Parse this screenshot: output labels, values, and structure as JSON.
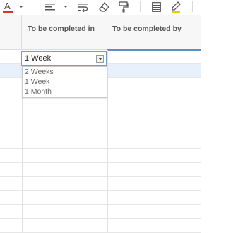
{
  "toolbar": {
    "icons": [
      "font-color-icon",
      "dropdown-arrow-icon",
      "align-left-icon",
      "dropdown-arrow-icon",
      "wrap-text-icon",
      "eraser-icon",
      "format-painter-icon",
      "freeze-columns-icon",
      "highlighter-icon"
    ],
    "font_color_letter": "A",
    "font_color": "#d9342b"
  },
  "columns": {
    "c1": {
      "label": "To be completed in"
    },
    "c2": {
      "label": "To be completed by"
    }
  },
  "active_cell": {
    "value": "1 Week",
    "options": [
      "2 Weeks",
      "1 Week",
      "1 Month"
    ]
  },
  "colors": {
    "header_bg": "#f7f7f7",
    "selection_row": "#e8f1fb",
    "accent": "#5b8fc7"
  }
}
